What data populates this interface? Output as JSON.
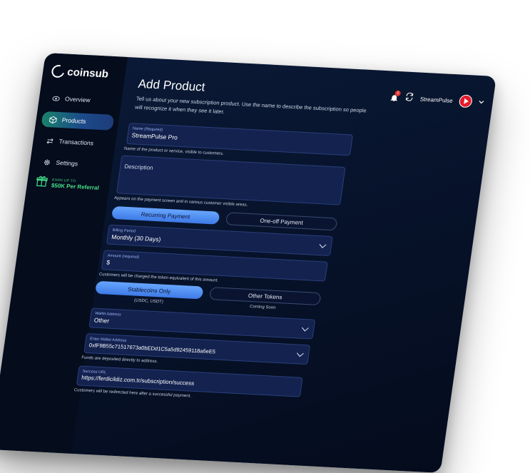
{
  "brand": {
    "name": "coinsub"
  },
  "sidebar": {
    "items": [
      {
        "label": "Overview",
        "icon": "eye-icon"
      },
      {
        "label": "Products",
        "icon": "cube-icon",
        "active": true
      },
      {
        "label": "Transactions",
        "icon": "exchange-icon"
      },
      {
        "label": "Settings",
        "icon": "gear-icon"
      }
    ],
    "referral": {
      "small": "EARN UP TO",
      "big": "$50K Per Referral"
    }
  },
  "header": {
    "title": "Add Product",
    "intro": "Tell us about your new subscription product. Use the name to describe the subscription so people will recognize it when they see it later.",
    "notification_count": "2",
    "user_name": "StreamPulse"
  },
  "form": {
    "name": {
      "label": "Name (Required)",
      "value": "StreamPulse Pro",
      "help": "Name of the product or service, visible to customers."
    },
    "description": {
      "placeholder": "Description",
      "help": "Appears on the payment screen and in various customer visible areas."
    },
    "payment_type": {
      "options": [
        "Recurring Payment",
        "One-off Payment"
      ],
      "selected": "Recurring Payment"
    },
    "billing_period": {
      "label": "Billing Period",
      "value": "Monthly (30 Days)"
    },
    "amount": {
      "label": "Amount (required)",
      "value": "$",
      "help": "Customers will be charged the token equivalent of this amount."
    },
    "token_type": {
      "options": [
        {
          "label": "Stablecoins Only",
          "note": "(USDC, USDT)"
        },
        {
          "label": "Other Tokens",
          "note": "Coming Soon"
        }
      ],
      "selected": "Stablecoins Only"
    },
    "wallet_address": {
      "label": "Wallet Address",
      "value": "Other"
    },
    "enter_wallet_address": {
      "label": "Enter Wallet Address",
      "value": "0xfF9B55c71517673a0bEDd1C5a5d92459118a6eE5",
      "help": "Funds are deposited directly to address."
    },
    "success_url": {
      "label": "Success URL",
      "value": "https://ferdicildiz.com.tr/subscription/success",
      "help": "Customers will be redirected here after a successful payment."
    }
  },
  "colors": {
    "accent": "#4a8cf5",
    "active_nav_start": "#19826a",
    "referral_green": "#44e08a",
    "background": "#07132b"
  }
}
